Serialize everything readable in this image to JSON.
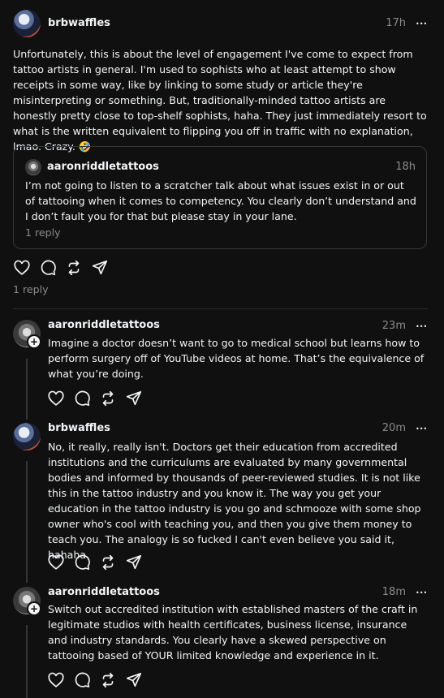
{
  "main_post": {
    "username": "brbwaffles",
    "time": "17h",
    "text": "Unfortunately, this is about the level of engagement I've come to expect from tattoo artists in general. I'm used to sophists who at least attempt to show receipts in some way, like by linking to some study or article they're misinterpreting or something. But, traditionally-minded tattoo artists are honestly pretty close to top-shelf sophists, haha. They just immediately resort to what is the written equivalent to flipping you off in traffic with no explanation, lmao. Crazy. 🤣",
    "quoted": {
      "username": "aaronriddletattoos",
      "time": "18h",
      "text": "I’m not going to listen to a scratcher talk about what issues exist in or out of tattooing when it comes to competency. You clearly don’t understand and I don’t fault you for that but please stay in your lane.",
      "replies": "1 reply"
    },
    "replies": "1 reply"
  },
  "replies": [
    {
      "username": "aaronriddletattoos",
      "time": "23m",
      "text": "Imagine a doctor doesn’t want to go to medical school but learns how to perform surgery off of YouTube videos at home. That’s the equivalence of what you’re doing."
    },
    {
      "username": "brbwaffles",
      "time": "20m",
      "text": "No, it really, really isn't. Doctors get their education from accredited institutions and the curriculums are evaluated by many governmental bodies and informed by thousands of peer-reviewed studies. It is not like this in the tattoo industry and you know it. The way you get your education in the tattoo industry is you go and schmooze with some shop owner who's cool with teaching you, and then you give them money to teach you. The analogy is so fucked I can't even believe you said it, hahaha."
    },
    {
      "username": "aaronriddletattoos",
      "time": "18m",
      "text": "Switch out accredited institution with established masters of the craft in legitimate studios with health certificates, business license, insurance and industry standards. You clearly have a skewed perspective on tattooing based of YOUR limited knowledge and experience in it."
    }
  ],
  "icons": [
    "heart-icon",
    "comment-icon",
    "repost-icon",
    "share-icon",
    "more-icon",
    "follow-plus-icon"
  ],
  "more_glyph": "•••",
  "plus_glyph": "+"
}
